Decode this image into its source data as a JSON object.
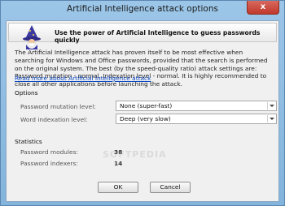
{
  "window": {
    "title": "Artificial Intelligence attack options",
    "close_glyph": "x"
  },
  "banner": {
    "text": "Use the power of Artificial Intelligence to guess passwords quickly",
    "icon": "wizard-icon"
  },
  "description": "The Artificial Intelligence attack has proven itself to be most effective when searching for Windows and Office passwords, provided that the search is performed on the original system. The best (by the speed-quality ratio) attack settings are: Password mutation - normal, Indexation level - normal. It is highly recommended to close all other applications before launching the attack.",
  "link_text": "Read more about Artificial Intelligence attack",
  "options": {
    "title": "Options",
    "mutation_label": "Password mutation level:",
    "mutation_value": "None (super-fast)",
    "indexation_label": "Word indexation level:",
    "indexation_value": "Deep (very slow)"
  },
  "statistics": {
    "title": "Statistics",
    "modules_label": "Password modules:",
    "modules_value": "38",
    "indexers_label": "Password indexers:",
    "indexers_value": "14"
  },
  "watermark": "SOFTPEDIA",
  "buttons": {
    "ok": "OK",
    "cancel": "Cancel"
  }
}
